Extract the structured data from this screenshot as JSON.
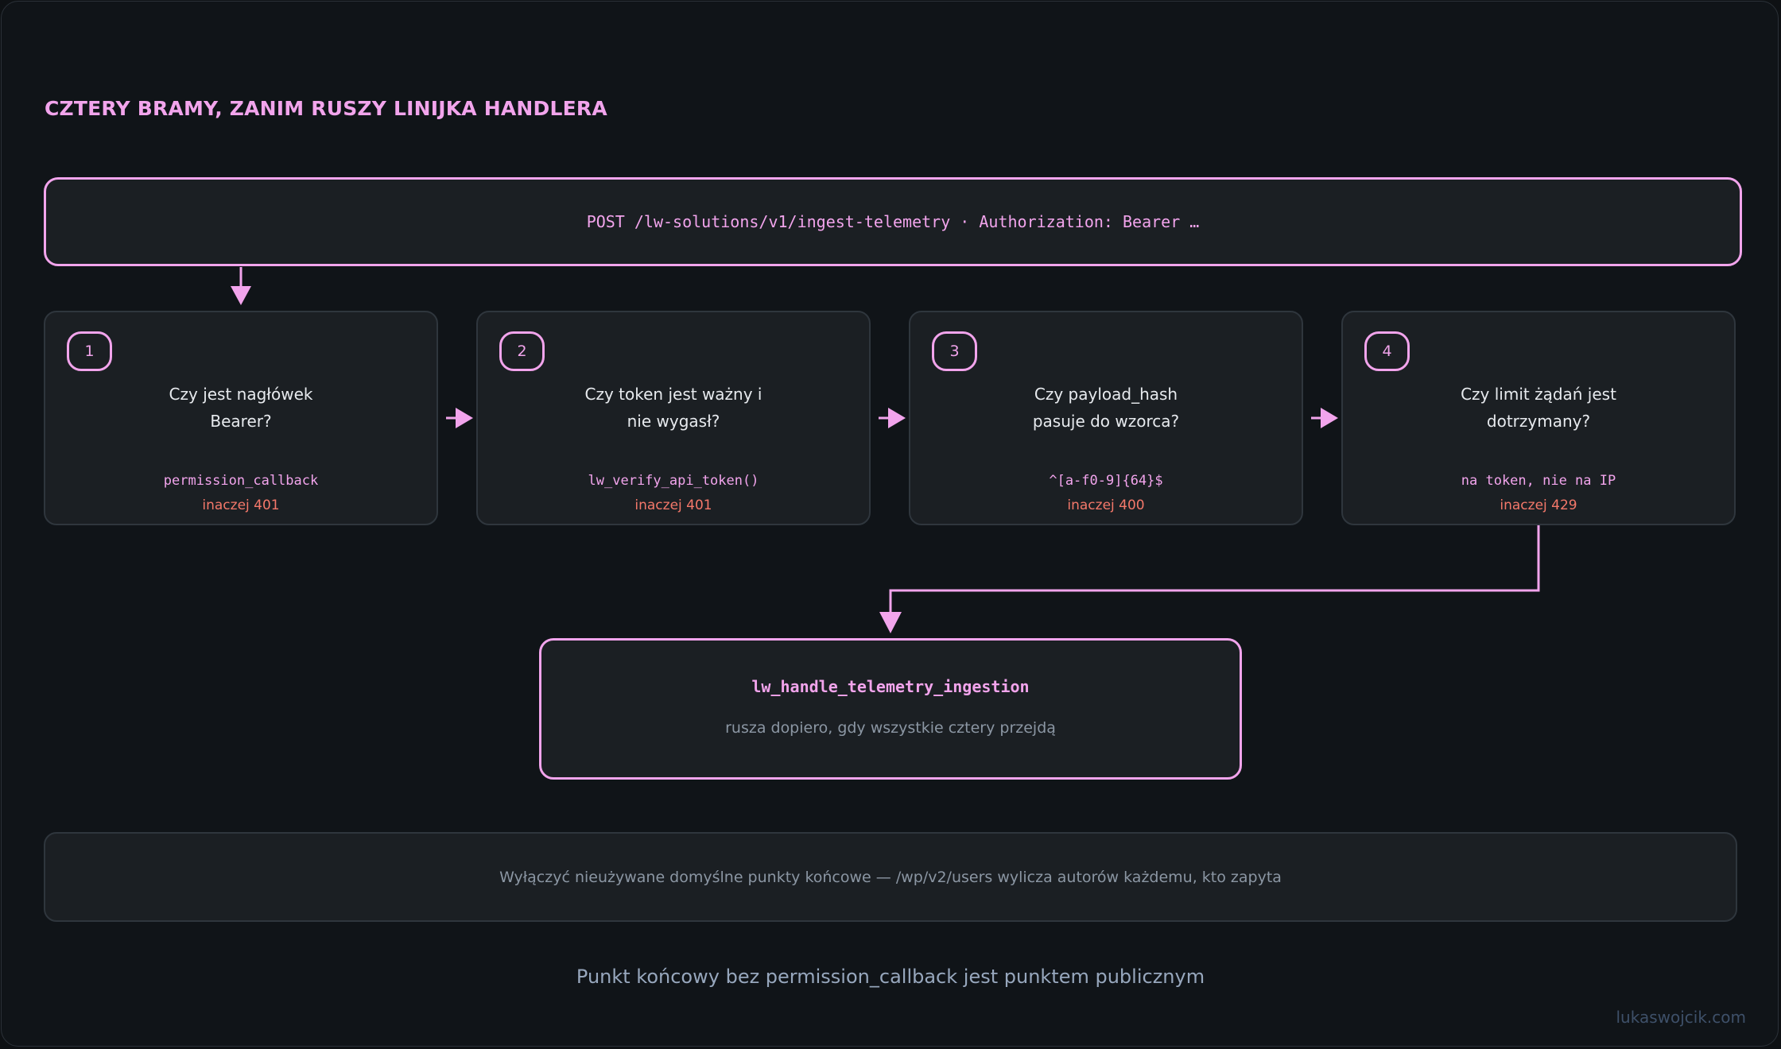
{
  "title": "CZTERY BRAMY, ZANIM RUSZY LINIJKA HANDLERA",
  "request": "POST /lw-solutions/v1/ingest-telemetry · Authorization: Bearer …",
  "gates": [
    {
      "number": "1",
      "question": [
        "Czy jest nagłówek",
        "Bearer?"
      ],
      "code": "permission_callback",
      "error": "inaczej 401"
    },
    {
      "number": "2",
      "question": [
        "Czy token jest ważny i",
        "nie wygasł?"
      ],
      "code": "lw_verify_api_token()",
      "error": "inaczej 401"
    },
    {
      "number": "3",
      "question": [
        "Czy payload_hash",
        "pasuje do wzorca?"
      ],
      "code": "^[a-f0-9]{64}$",
      "error": "inaczej 400"
    },
    {
      "number": "4",
      "question": [
        "Czy limit żądań jest",
        "dotrzymany?"
      ],
      "code": "na token, nie na IP",
      "error": "inaczej 429"
    }
  ],
  "handler": {
    "name": "lw_handle_telemetry_ingestion",
    "subtitle": "rusza dopiero, gdy wszystkie cztery przejdą"
  },
  "note": "Wyłączyć nieużywane domyślne punkty końcowe — /wp/v2/users wylicza autorów każdemu, kto zapyta",
  "caption": "Punkt końcowy bez permission_callback jest punktem publicznym",
  "footer": "lukaswojcik.com",
  "colors": {
    "accent": "#f2a4ec",
    "error": "#f4786a",
    "background": "#101418",
    "card": "#1b1f23"
  }
}
